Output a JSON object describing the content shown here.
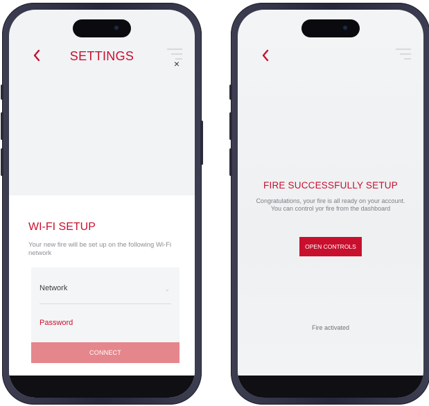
{
  "left_phone": {
    "header": {
      "title": "SETTINGS",
      "back_icon": "chevron-left-icon",
      "menu_icon": "hamburger-icon",
      "close_glyph": "×"
    },
    "wifi": {
      "title": "WI-FI SETUP",
      "description": "Your new fire will be set up on the following Wi-Fi network",
      "network_label": "Network",
      "network_chevron": "⌄",
      "password_label": "Password",
      "connect_label": "CONNECT"
    }
  },
  "right_phone": {
    "header": {
      "back_icon": "chevron-left-icon",
      "menu_icon": "hamburger-icon"
    },
    "success": {
      "title": "FIRE SUCCESSFULLY SETUP",
      "text": "Congratulations, your fire is all ready on your account. You can control yor fire from the dashboard",
      "button_label": "OPEN CONTROLS",
      "status": "Fire activated"
    }
  },
  "colors": {
    "accent": "#c8102e",
    "connect_disabled": "#e5868c",
    "frame": "#2f2f42"
  }
}
